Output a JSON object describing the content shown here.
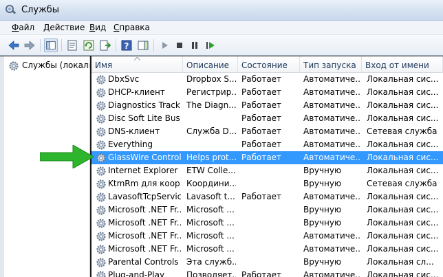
{
  "window": {
    "title": "Службы"
  },
  "menu": [
    {
      "pre": "",
      "u": "Ф",
      "post": "айл"
    },
    {
      "pre": "",
      "u": "Д",
      "post": "ействие"
    },
    {
      "pre": "",
      "u": "В",
      "post": "ид"
    },
    {
      "pre": "",
      "u": "С",
      "post": "правка"
    }
  ],
  "toolbar": {
    "icons": [
      "back-icon",
      "forward-icon",
      "show-hide-tree-icon",
      "properties-icon",
      "refresh-icon",
      "export-list-icon",
      "help-icon",
      "show-action-pane-icon",
      "start-service-icon",
      "stop-service-icon",
      "pause-service-icon",
      "restart-service-icon"
    ]
  },
  "tree": {
    "root_label": "Службы (локальные)"
  },
  "table": {
    "columns": [
      "Имя",
      "Описание",
      "Состояние",
      "Тип запуска",
      "Вход от имени"
    ],
    "selected_index": 6,
    "rows": [
      {
        "name": "DbxSvc",
        "desc": "Dropbox S...",
        "state": "Работает",
        "start": "Автоматиче...",
        "logon": "Локальная сис..."
      },
      {
        "name": "DHCP-клиент",
        "desc": "Регистрир...",
        "state": "Работает",
        "start": "Автоматиче...",
        "logon": "Локальная сис..."
      },
      {
        "name": "Diagnostics Tracki...",
        "desc": "The Diagn...",
        "state": "Работает",
        "start": "Автоматиче...",
        "logon": "Локальная сис..."
      },
      {
        "name": "Disc Soft Lite Bus ...",
        "desc": "",
        "state": "Работает",
        "start": "Автоматиче...",
        "logon": "Локальная сис..."
      },
      {
        "name": "DNS-клиент",
        "desc": "Служба D...",
        "state": "Работает",
        "start": "Автоматиче...",
        "logon": "Сетевая служба"
      },
      {
        "name": "Everything",
        "desc": "",
        "state": "Работает",
        "start": "Автоматиче...",
        "logon": "Локальная сис..."
      },
      {
        "name": "GlassWire Control ...",
        "desc": "Helps prot...",
        "state": "Работает",
        "start": "Автоматиче...",
        "logon": "Локальная сис..."
      },
      {
        "name": "Internet Explorer E...",
        "desc": "ETW Colle...",
        "state": "",
        "start": "Вручную",
        "logon": "Локальная сис..."
      },
      {
        "name": "KtmRm для коор...",
        "desc": "Координи...",
        "state": "",
        "start": "Вручную",
        "logon": "Сетевая служба"
      },
      {
        "name": "LavasoftTcpService",
        "desc": "Lavasoft t...",
        "state": "Работает",
        "start": "Автоматиче...",
        "logon": "Локальная сис..."
      },
      {
        "name": "Microsoft .NET Fr...",
        "desc": "Microsoft ...",
        "state": "",
        "start": "Вручную",
        "logon": "Локальная сис..."
      },
      {
        "name": "Microsoft .NET Fr...",
        "desc": "Microsoft ...",
        "state": "",
        "start": "Вручную",
        "logon": "Локальная сис..."
      },
      {
        "name": "Microsoft .NET Fr...",
        "desc": "Microsoft ...",
        "state": "",
        "start": "Автоматиче...",
        "logon": "Локальная сис..."
      },
      {
        "name": "Microsoft .NET Fr...",
        "desc": "Microsoft ...",
        "state": "",
        "start": "Автоматиче...",
        "logon": "Локальная сис..."
      },
      {
        "name": "Parental Controls",
        "desc": "Эта служб...",
        "state": "",
        "start": "Вручную",
        "logon": "Локальная сл..."
      },
      {
        "name": "Plug-and-Play",
        "desc": "Позволяет...",
        "state": "Работает",
        "start": "Автоматиче...",
        "logon": "Локальная сис..."
      }
    ]
  },
  "annotation": {
    "icon": "green-arrow-icon",
    "color": "#2db52d"
  },
  "colors": {
    "selection": "#3399ff"
  }
}
